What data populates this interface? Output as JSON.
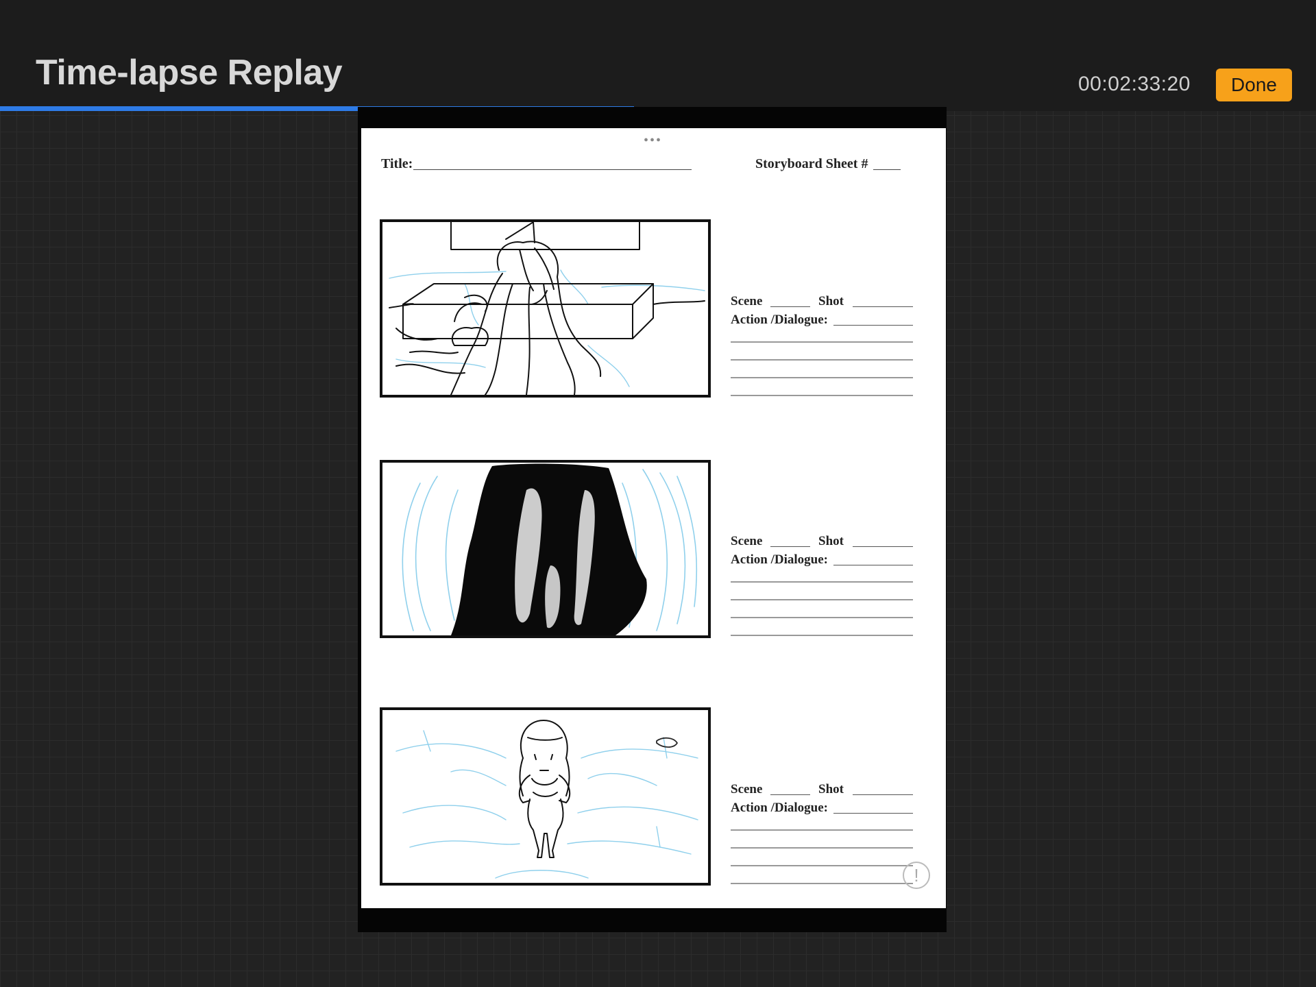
{
  "header": {
    "title": "Time-lapse Replay",
    "timecode": "00:02:33:20",
    "done_label": "Done",
    "accent_color": "#f7a11a"
  },
  "playback": {
    "progress_fraction": 0.482,
    "progress_color": "#2e7be6"
  },
  "canvas": {
    "menu_dots": "•••",
    "title_label": "Title:",
    "sheet_label": "Storyboard Sheet #",
    "info_icon": "!",
    "panels": [
      {
        "scene_label": "Scene",
        "shot_label": "Shot",
        "action_label": "Action /Dialogue:"
      },
      {
        "scene_label": "Scene",
        "shot_label": "Shot",
        "action_label": "Action /Dialogue:"
      },
      {
        "scene_label": "Scene",
        "shot_label": "Shot",
        "action_label": "Action /Dialogue:"
      }
    ]
  }
}
